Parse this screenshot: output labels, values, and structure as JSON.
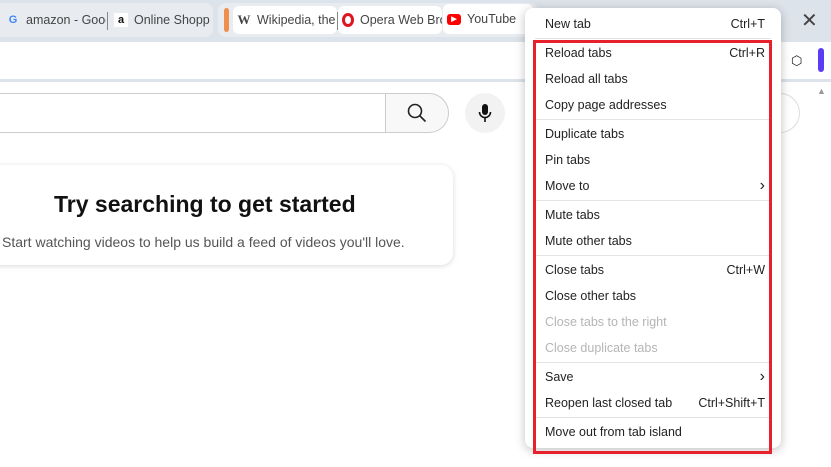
{
  "tabs": [
    {
      "title": "amazon - Goog",
      "icon": "google-icon"
    },
    {
      "title": "Online Shoppin",
      "icon": "amazon-icon"
    },
    {
      "title": "Wikipedia, the f",
      "icon": "wikipedia-icon"
    },
    {
      "title": "Opera Web Bro",
      "icon": "opera-icon"
    },
    {
      "title": "YouTube",
      "icon": "youtube-icon"
    }
  ],
  "colors": {
    "island": "#ef8f4e",
    "highlight": "#e8202b",
    "accent": "#5b3cf5"
  },
  "page": {
    "heading": "Try searching to get started",
    "subtext": "Start watching videos to help us build a feed of videos you'll love."
  },
  "menu": [
    {
      "label": "New tab",
      "shortcut": "Ctrl+T"
    },
    {
      "label": "Reload tabs",
      "shortcut": "Ctrl+R"
    },
    {
      "label": "Reload all tabs",
      "shortcut": ""
    },
    {
      "label": "Copy page addresses",
      "shortcut": ""
    },
    {
      "label": "Duplicate tabs",
      "shortcut": ""
    },
    {
      "label": "Pin tabs",
      "shortcut": ""
    },
    {
      "label": "Move to",
      "shortcut": "›"
    },
    {
      "label": "Mute tabs",
      "shortcut": ""
    },
    {
      "label": "Mute other tabs",
      "shortcut": ""
    },
    {
      "label": "Close tabs",
      "shortcut": "Ctrl+W"
    },
    {
      "label": "Close other tabs",
      "shortcut": ""
    },
    {
      "label": "Close tabs to the right",
      "shortcut": "",
      "disabled": true
    },
    {
      "label": "Close duplicate tabs",
      "shortcut": "",
      "disabled": true
    },
    {
      "label": "Save",
      "shortcut": "›"
    },
    {
      "label": "Reopen last closed tab",
      "shortcut": "Ctrl+Shift+T"
    },
    {
      "label": "Move out from tab island",
      "shortcut": ""
    }
  ]
}
